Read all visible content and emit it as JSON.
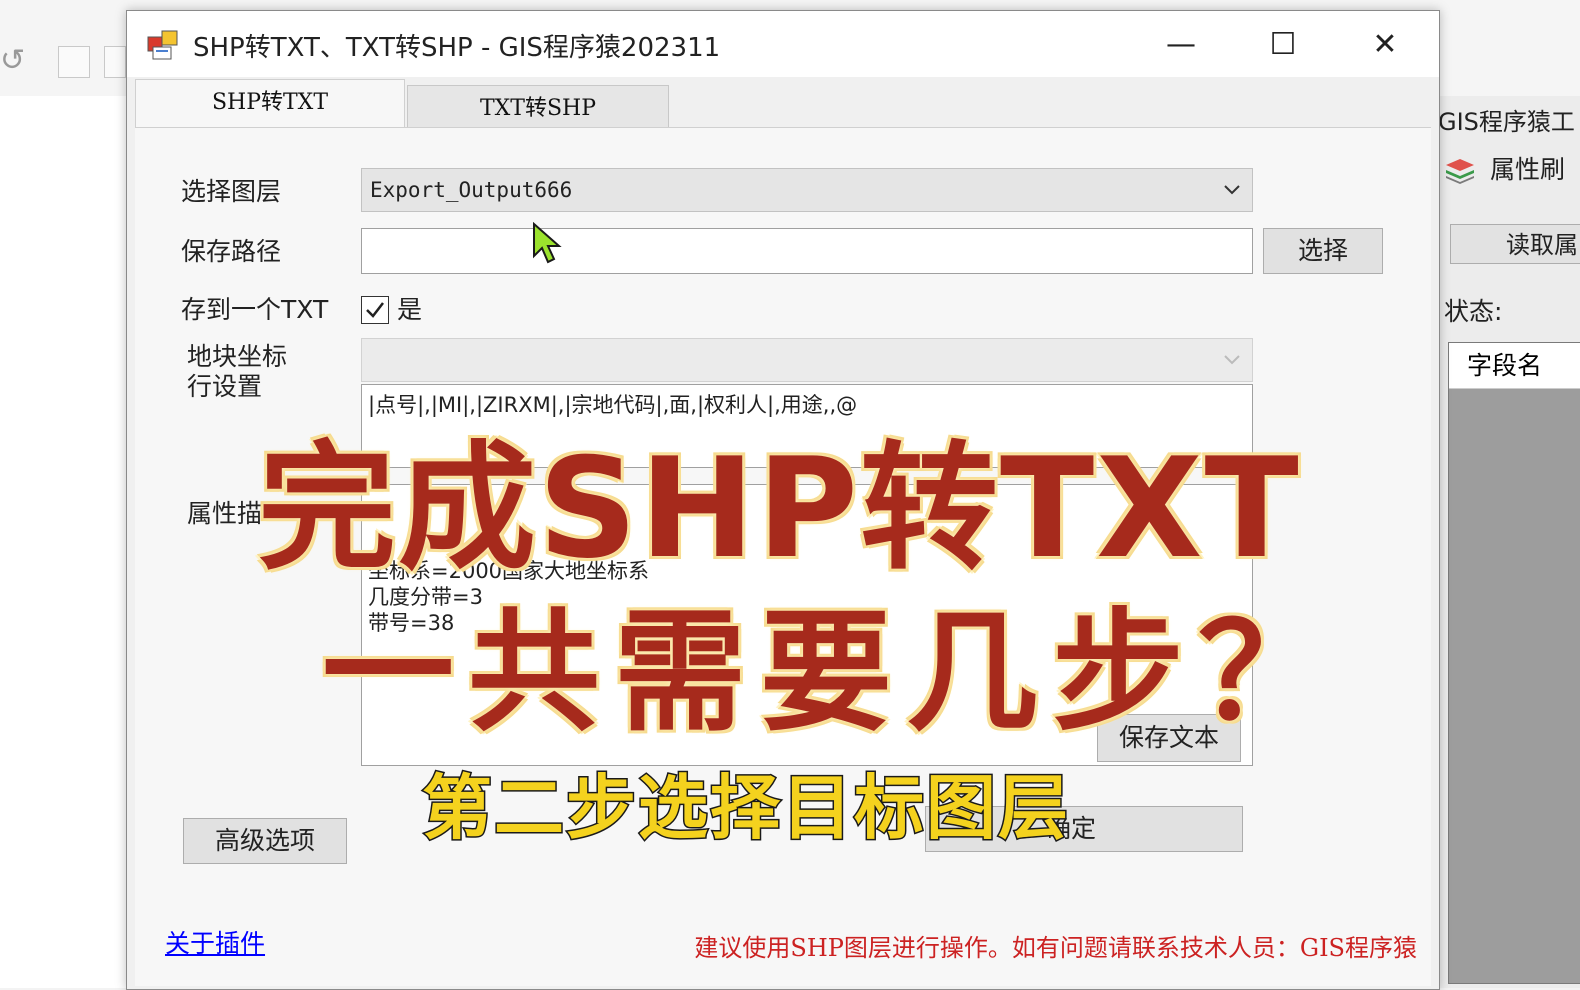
{
  "background_app": {
    "right_panel": {
      "title": "GIS程序猿工",
      "layer_tool": "属性刷",
      "read_button": "读取属",
      "status_label": "状态:",
      "grid_header": "字段名"
    }
  },
  "dialog": {
    "title": "SHP转TXT、TXT转SHP - GIS程序猿202311",
    "controls": {
      "minimize": "—",
      "maximize": "☐",
      "close": "✕"
    },
    "tabs": [
      {
        "label": "SHP转TXT",
        "active": true
      },
      {
        "label": "TXT转SHP",
        "active": false
      }
    ],
    "form": {
      "layer_label": "选择图层",
      "layer_value": "Export_Output666",
      "path_label": "保存路径",
      "path_value": "",
      "browse_button": "选择",
      "single_txt_label": "存到一个TXT",
      "single_txt_checked": true,
      "single_txt_option": "是",
      "parcel_label_line1": "地块坐标",
      "parcel_label_line2": "行设置",
      "parcel_row_text": "|点号|,|MI|,|ZIRXM|,|宗地代码|,面,|权利人|,用途,,@",
      "attr_label": "属性描",
      "attr_lines": [
        "坐标系=2000国家大地坐标系",
        "几度分带=3",
        "带号=38"
      ],
      "save_text_button": "保存文本",
      "advanced_button": "高级选项",
      "ok_button": "确定"
    },
    "footer": {
      "about_link": "关于插件",
      "hint": "建议使用SHP图层进行操作。如有问题请联系技术人员：GIS程序猿"
    }
  },
  "overlay": {
    "headline_line1": "完成SHP转TXT",
    "headline_line2": "一共需要几步？",
    "subtitle": "第二步选择目标图层"
  },
  "colors": {
    "headline_fill": "#a62a1c",
    "headline_outline": "#fff3c4",
    "subtitle_fill": "#f4d21e",
    "hint_text": "#cc2222",
    "link": "#0000ff",
    "cursor": "#9be22d"
  }
}
